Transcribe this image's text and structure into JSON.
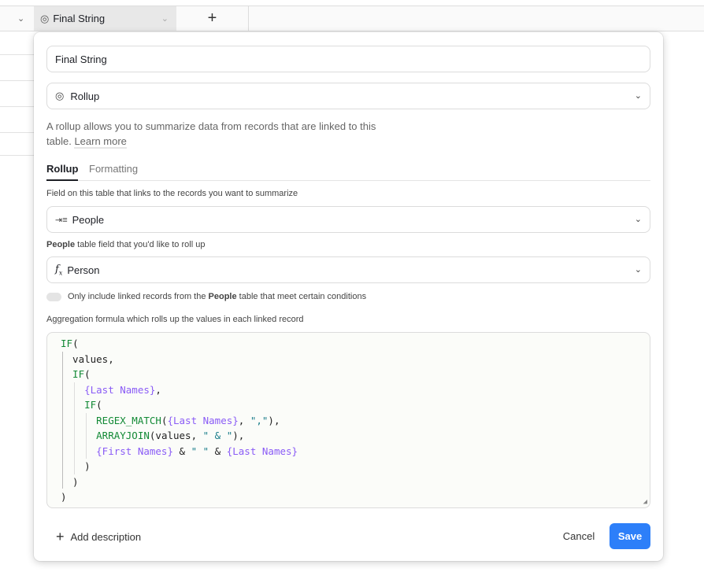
{
  "header": {
    "column_title": "Final String",
    "add_column_icon": "plus-icon"
  },
  "dialog": {
    "field_name": "Final String",
    "field_type": "Rollup",
    "type_icon": "rollup-spiral-icon",
    "description": "A rollup allows you to summarize data from records that are linked to this",
    "description_line2": "table.",
    "learn_more": "Learn more",
    "tabs": [
      {
        "label": "Rollup",
        "active": true
      },
      {
        "label": "Formatting",
        "active": false
      }
    ],
    "link_field_label": "Field on this table that links to the records you want to summarize",
    "link_field_value": "People",
    "rollup_field_label_bold": "People",
    "rollup_field_label_rest": " table field that you'd like to roll up",
    "rollup_field_value": "Person",
    "toggle": {
      "on": false,
      "pre": "Only include linked records from the ",
      "bold": "People",
      "post": " table that meet certain conditions"
    },
    "formula_label": "Aggregation formula which rolls up the values in each linked record",
    "formula_lines": [
      [
        [
          "k",
          "IF"
        ],
        [
          "p",
          "("
        ]
      ],
      [
        [
          "p",
          "  values,"
        ]
      ],
      [
        [
          "k",
          "  IF"
        ],
        [
          "p",
          "("
        ]
      ],
      [
        [
          "f",
          "    {Last Names}"
        ],
        [
          "p",
          ","
        ]
      ],
      [
        [
          "k",
          "    IF"
        ],
        [
          "p",
          "("
        ]
      ],
      [
        [
          "k",
          "      REGEX_MATCH"
        ],
        [
          "p",
          "("
        ],
        [
          "f",
          "{Last Names}"
        ],
        [
          "p",
          ", "
        ],
        [
          "s",
          "\",\""
        ],
        [
          "p",
          "),"
        ]
      ],
      [
        [
          "k",
          "      ARRAYJOIN"
        ],
        [
          "p",
          "(values, "
        ],
        [
          "s",
          "\" & \""
        ],
        [
          "p",
          "),"
        ]
      ],
      [
        [
          "f",
          "      {First Names}"
        ],
        [
          "p",
          " & "
        ],
        [
          "s",
          "\" \""
        ],
        [
          "p",
          " & "
        ],
        [
          "f",
          "{Last Names}"
        ]
      ],
      [
        [
          "p",
          "    )"
        ]
      ],
      [
        [
          "p",
          "  )"
        ]
      ],
      [
        [
          "p",
          ")"
        ]
      ]
    ],
    "add_description": "Add description",
    "cancel": "Cancel",
    "save": "Save",
    "accent": "#2d7ff9"
  }
}
